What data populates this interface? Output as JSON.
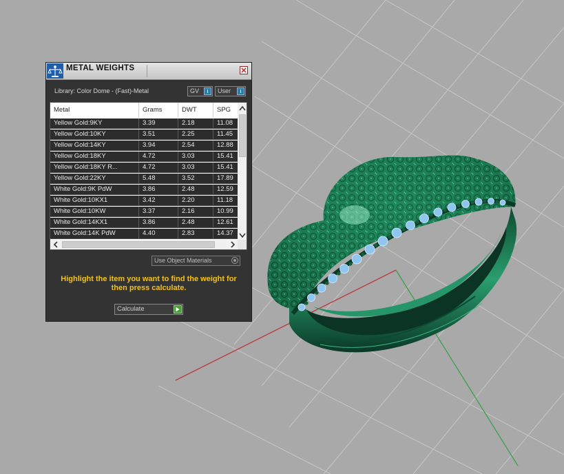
{
  "panel": {
    "title": "METAL WEIGHTS",
    "library_label": "Library: Color Dome - (Fast)-Metal",
    "toggles": {
      "gv_label": "GV",
      "user_label": "User"
    },
    "columns": [
      "Metal",
      "Grams",
      "DWT",
      "SPG"
    ],
    "rows": [
      {
        "metal": "Yellow Gold:9KY",
        "grams": "3.39",
        "dwt": "2.18",
        "spg": "11.08"
      },
      {
        "metal": "Yellow Gold:10KY",
        "grams": "3.51",
        "dwt": "2.25",
        "spg": "11.45"
      },
      {
        "metal": "Yellow Gold:14KY",
        "grams": "3.94",
        "dwt": "2.54",
        "spg": "12.88"
      },
      {
        "metal": "Yellow Gold:18KY",
        "grams": "4.72",
        "dwt": "3.03",
        "spg": "15.41"
      },
      {
        "metal": "Yellow Gold:18KY R...",
        "grams": "4.72",
        "dwt": "3.03",
        "spg": "15.41"
      },
      {
        "metal": "Yellow Gold:22KY",
        "grams": "5.48",
        "dwt": "3.52",
        "spg": "17.89"
      },
      {
        "metal": "White Gold:9K PdW",
        "grams": "3.86",
        "dwt": "2.48",
        "spg": "12.59"
      },
      {
        "metal": "White Gold:10KX1",
        "grams": "3.42",
        "dwt": "2.20",
        "spg": "11.18"
      },
      {
        "metal": "White Gold:10KW",
        "grams": "3.37",
        "dwt": "2.16",
        "spg": "10.99"
      },
      {
        "metal": "White Gold:14KX1",
        "grams": "3.86",
        "dwt": "2.48",
        "spg": "12.61"
      },
      {
        "metal": "White Gold:14K PdW",
        "grams": "4.40",
        "dwt": "2.83",
        "spg": "14.37"
      }
    ],
    "use_object_materials_label": "Use Object Materials",
    "instructions": "Highlight the item you want to find the weight for then press calculate.",
    "calculate_label": "Calculate"
  },
  "colors": {
    "ring_metal": "#1e7a52",
    "gemstones": "#8fc6f0",
    "instruction_text": "#f2c21a",
    "panel_background": "#333333",
    "viewport_background": "#a9a9a9",
    "x_axis": "#b83a3a",
    "y_axis": "#3aa04a"
  }
}
